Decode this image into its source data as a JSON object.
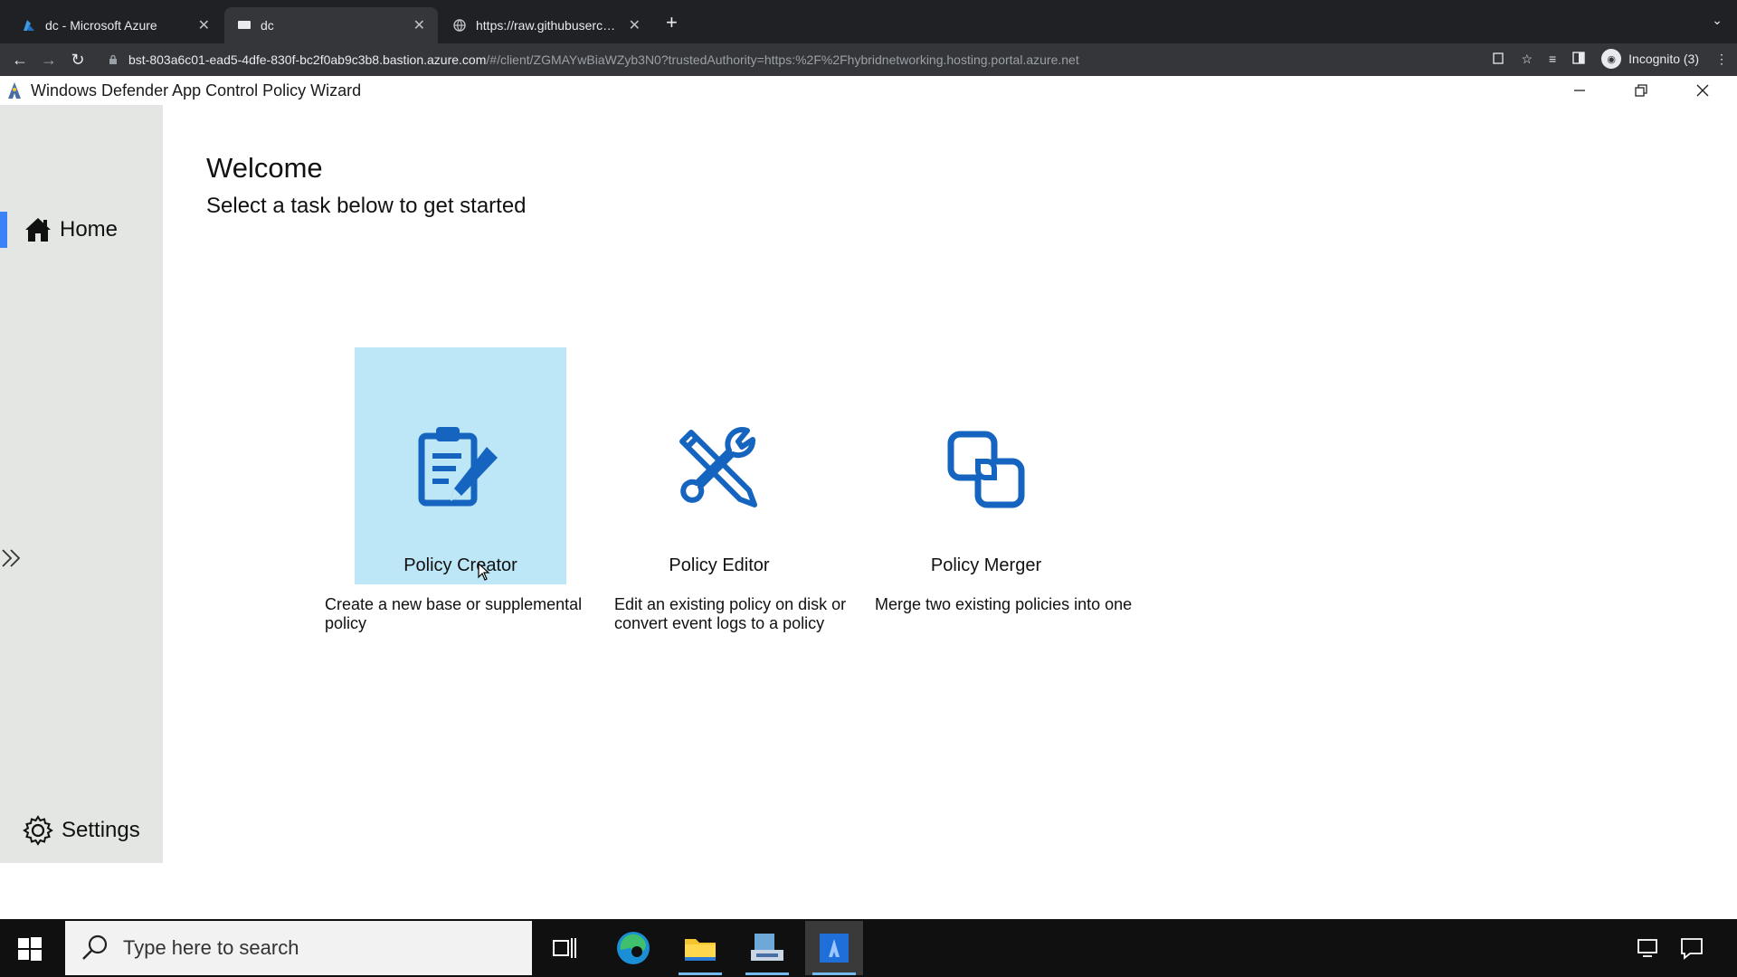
{
  "browser": {
    "tabs": [
      {
        "title": "dc - Microsoft Azure",
        "favicon": "azure-icon"
      },
      {
        "title": "dc",
        "favicon": "remote-desktop-icon"
      },
      {
        "title": "https://raw.githubusercontent...",
        "favicon": "globe-icon"
      }
    ],
    "url_host": "bst-803a6c01-ead5-4dfe-830f-bc2f0ab9c3b8.bastion.azure.com",
    "url_rest": "/#/client/ZGMAYwBiaWZyb3N0?trustedAuthority=https:%2F%2Fhybridnetworking.hosting.portal.azure.net",
    "profile_label": "Incognito (3)"
  },
  "app": {
    "title": "Windows Defender App Control Policy Wizard",
    "sidebar": {
      "home_label": "Home",
      "settings_label": "Settings"
    },
    "welcome_title": "Welcome",
    "welcome_subtitle": "Select a task below to get started",
    "tasks": [
      {
        "name": "Policy Creator",
        "description": "Create a new base or supplemental policy",
        "icon": "clipboard-pencil-icon",
        "selected": true
      },
      {
        "name": "Policy Editor",
        "description": "Edit an existing policy on disk or convert event logs to a policy",
        "icon": "wrench-pencil-icon",
        "selected": false
      },
      {
        "name": "Policy Merger",
        "description": "Merge two existing policies into one",
        "icon": "merge-squares-icon",
        "selected": false
      }
    ],
    "accent_color": "#1565c0",
    "selected_tile_color": "#bde6f6"
  },
  "taskbar": {
    "search_placeholder": "Type here to search"
  }
}
